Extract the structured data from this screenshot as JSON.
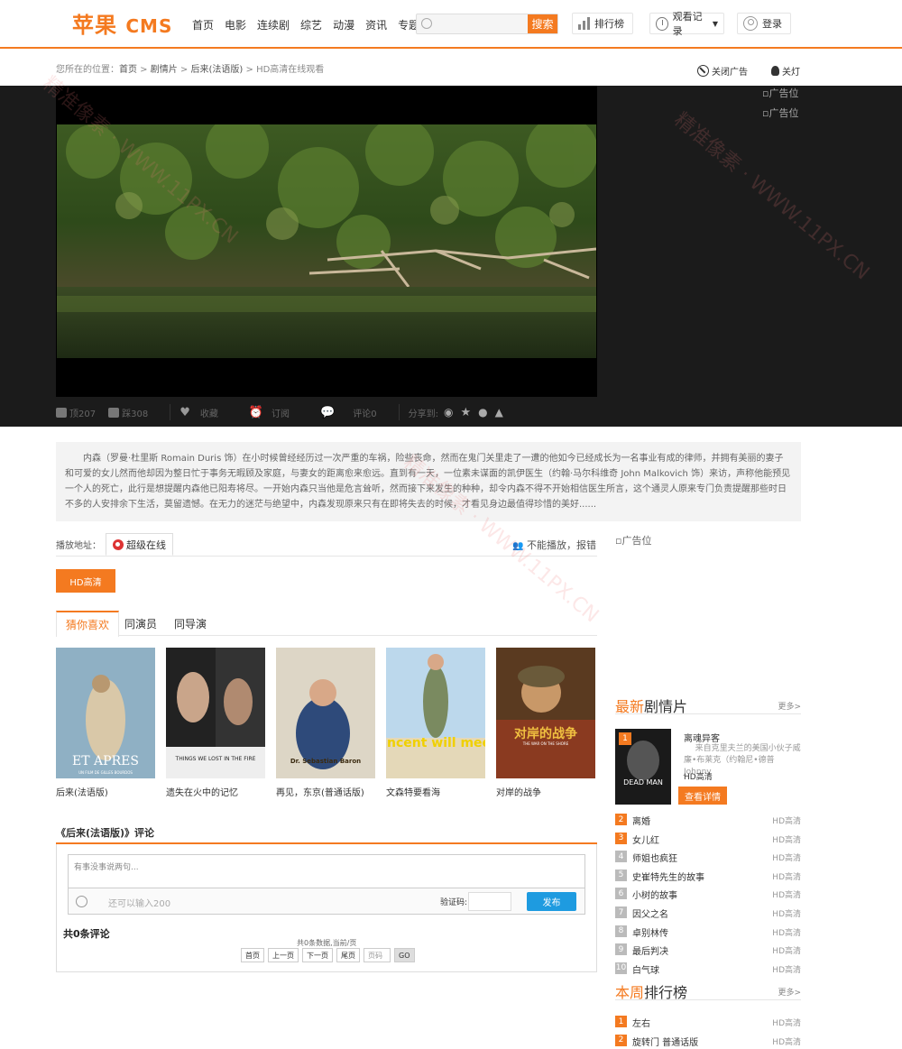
{
  "header": {
    "logo_main": "苹果",
    "logo_cms": "CMS",
    "nav": [
      "首页",
      "电影",
      "连续剧",
      "综艺",
      "动漫",
      "资讯",
      "专题"
    ],
    "search_placeholder": "",
    "search_btn": "搜索",
    "rank_btn": "排行榜",
    "history_btn": "观看记录",
    "login_btn": "登录"
  },
  "breadcrumb": {
    "prefix": "您所在的位置：",
    "home": "首页",
    "sep1": " > ",
    "cat": "剧情片",
    "sep2": " > ",
    "title": "后来(法语版)",
    "sep3": " > ",
    "current": "HD高清在线观看"
  },
  "top_actions": {
    "close_ad": "关闭广告",
    "lights": "关灯"
  },
  "ads": {
    "slot1": "广告位",
    "slot2": "广告位",
    "side": "广告位"
  },
  "toolbar": {
    "up": "顶207",
    "down": "踩308",
    "fav": "收藏",
    "sub": "订阅",
    "comment": "评论0",
    "share": "分享到:"
  },
  "description": "内森（罗曼·杜里斯 Romain Duris 饰）在小时候曾经经历过一次严重的车祸，险些丧命，然而在鬼门关里走了一遭的他如今已经成长为一名事业有成的律师，并拥有美丽的妻子和可爱的女儿然而他却因为整日忙于事务无暇顾及家庭，与妻女的距离愈来愈远。直到有一天，一位素未谋面的凯伊医生（约翰·马尔科维奇 John Malkovich 饰）来访，声称他能预见一个人的死亡，此行是想提醒内森他已阳寿将尽。一开始内森只当他是危言耸听，然而接下来发生的种种，却令内森不得不开始相信医生所言，这个通灵人原来专门负责提醒那些时日不多的人安排余下生活，莫留遗憾。在无力的迷茫与绝望中，内森发现原来只有在即将失去的时候，才看见身边最值得珍惜的美好......",
  "play": {
    "label": "播放地址：",
    "source": "超级在线",
    "report": "不能播放，报错",
    "episode": "HD高清"
  },
  "like_tabs": [
    "猜你喜欢",
    "同演员",
    "同导演"
  ],
  "posters": [
    {
      "title": "后来(法语版)",
      "text": "ET APRES",
      "sub": "UN FILM DE GILLES BOURDOS",
      "bg": "#7fa0b6"
    },
    {
      "title": "遗失在火中的记忆",
      "text": "THINGS WE LOST IN THE FIRE",
      "sub": "",
      "bg": "#e6e6e6"
    },
    {
      "title": "再见，东京(普通话版)",
      "text": "Dr. Sebastian Baron",
      "sub": "",
      "bg": "#d9d4c6"
    },
    {
      "title": "文森特要看海",
      "text": "vincent will meer",
      "sub": "",
      "bg": "#b9d6ea"
    },
    {
      "title": "对岸的战争",
      "text": "对岸的战争",
      "sub": "THE WAR ON THE SHORE",
      "bg": "#5a3a20"
    }
  ],
  "comments": {
    "title": "《后来(法语版)》评论",
    "placeholder": "有事没事说两句...",
    "limit": "还可以输入200",
    "captcha_label": "验证码:",
    "post": "发布",
    "count": "共0条评论",
    "info": "共0条数据,当前/页",
    "pager": [
      "首页",
      "上一页",
      "下一页",
      "尾页",
      "页码",
      "GO"
    ]
  },
  "latest": {
    "title_hl": "最新",
    "title_rest": "剧情片",
    "more": "更多>",
    "featured": {
      "num": "1",
      "title": "离魂异客",
      "cast": "来自克里夫兰的美国小伙子威廉•布莱克（约翰尼•德普 Johnny",
      "quality": "HD高清",
      "btn": "查看详情",
      "poster_text": "DEAD MAN"
    },
    "items": [
      {
        "n": "2",
        "t": "离婚",
        "q": "HD高清"
      },
      {
        "n": "3",
        "t": "女儿红",
        "q": "HD高清"
      },
      {
        "n": "4",
        "t": "师姐也疯狂",
        "q": "HD高清"
      },
      {
        "n": "5",
        "t": "史崔特先生的故事",
        "q": "HD高清"
      },
      {
        "n": "6",
        "t": "小树的故事",
        "q": "HD高清"
      },
      {
        "n": "7",
        "t": "因父之名",
        "q": "HD高清"
      },
      {
        "n": "8",
        "t": "卓别林传",
        "q": "HD高清"
      },
      {
        "n": "9",
        "t": "最后判决",
        "q": "HD高清"
      },
      {
        "n": "10",
        "t": "白气球",
        "q": "HD高清"
      }
    ]
  },
  "weekly": {
    "title_hl": "本周",
    "title_rest": "排行榜",
    "more": "更多>",
    "items": [
      {
        "n": "1",
        "t": "左右",
        "q": "HD高清"
      },
      {
        "n": "2",
        "t": "旋转门 普通话版",
        "q": "HD高清"
      }
    ]
  },
  "colors": {
    "accent": "#f47a20",
    "blue": "#1e9be0"
  }
}
